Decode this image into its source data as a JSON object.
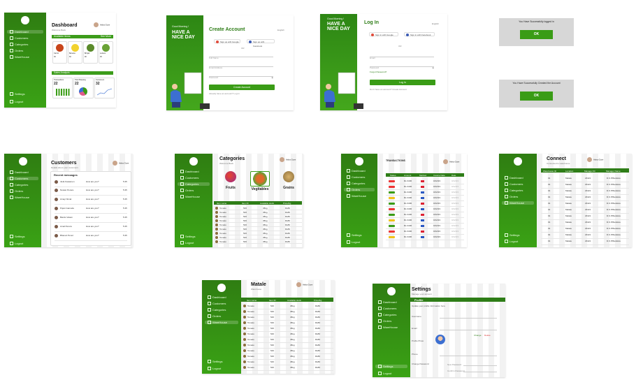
{
  "colors": {
    "brand_green": "#3a9c16",
    "dark_green": "#2e7d17"
  },
  "nav": {
    "dashboard": "Dashboard",
    "customers": "Customers",
    "categories": "Categories",
    "orders": "Orders",
    "warehouse": "WareHouse",
    "settings": "Settings",
    "logout": "Logout"
  },
  "profile": {
    "name": "Asha Gore",
    "role": "Project Manager"
  },
  "dashboard": {
    "title": "Dashboard",
    "subtitle": "Welcome Back",
    "available": "Available Items",
    "see_more": "See More",
    "items": [
      {
        "name": "Carrot",
        "value": "30"
      },
      {
        "name": "Banana",
        "value": "60"
      },
      {
        "name": "Brinjal",
        "value": "90"
      },
      {
        "name": "Lettuce",
        "value": "45"
      }
    ],
    "sales": "Sales Analysis",
    "stats": [
      {
        "label": "Transactions",
        "value": "22"
      },
      {
        "label": "Total Shipping",
        "value": "22"
      },
      {
        "label": "Customers",
        "value": "32"
      }
    ]
  },
  "create": {
    "hello": "Good Morning !",
    "big1": "HAVE A",
    "big2": "NICE DAY",
    "title": "Create Account",
    "lang": "English",
    "google": "Sign up with Google",
    "facebook": "Sign up with Facebook",
    "or": "OR",
    "f1": "Full Name",
    "f2": "Email Address",
    "f3": "Password",
    "button": "Create Account",
    "foot": "Already have an account? Log In"
  },
  "login": {
    "hello": "Good Morning !",
    "big1": "HAVE A",
    "big2": "NICE DAY",
    "title": "Log In",
    "lang": "English",
    "google": "Sign in with Google",
    "facebook": "Sign in with Facebook",
    "or": "OR",
    "f1": "Email",
    "f2": "Password",
    "forgot": "Forgot Password?",
    "button": "Log In",
    "foot": "Don't have an account? Create Account"
  },
  "modal1": {
    "msg": "You Have Successfully logged in",
    "ok": "OK"
  },
  "modal2": {
    "msg": "You Have Successfully Created the Account",
    "ok": "OK"
  },
  "customers": {
    "title": "Customers",
    "subtitle": "Details about your customers",
    "recent": "Recent messages",
    "rows": [
      {
        "name": "Jiefa Kawamen",
        "msg": "How are you?",
        "time": "5:45"
      },
      {
        "name": "Nuwan Perera",
        "msg": "How are you?",
        "time": "5:45"
      },
      {
        "name": "Amay Nimal",
        "msg": "How are you?",
        "time": "5:45"
      },
      {
        "name": "Pujan Gamude",
        "msg": "How are you?",
        "time": "5:45"
      },
      {
        "name": "Bandu Vasan",
        "msg": "How are you?",
        "time": "5:45"
      },
      {
        "name": "Amal Perera",
        "msg": "How are you?",
        "time": "5:45"
      },
      {
        "name": "Bhanuri Perez",
        "msg": "How are you?",
        "time": "5:45"
      }
    ]
  },
  "categories": {
    "title": "Categories",
    "subtitle": "Welcome Back",
    "cats": [
      "Fruits",
      "Vegitables",
      "Grains"
    ],
    "cols": [
      "Item name",
      "Item ID",
      "Available stock",
      "Price/Kg"
    ],
    "row": [
      "Tomato",
      "546",
      "45kg",
      "Rs80"
    ]
  },
  "transactions": {
    "title": "TRANSACTIONS",
    "cols": [
      "Status",
      "Amount",
      "Method",
      "Invoice Date",
      "Date"
    ],
    "amount": "Rs 3400",
    "invoice": "0/12/23",
    "date": "0/12/23"
  },
  "connect": {
    "title": "Connect",
    "subtitle": "Connected to warehouse",
    "cols": [
      "Warehouse ID",
      "Location",
      "Manager ID",
      "Manager Name"
    ],
    "row": [
      "01",
      "Matale",
      "23421",
      "D.K.P.Bandara"
    ]
  },
  "matale": {
    "title": "Matale",
    "subtitle": "Warehouse",
    "cols": [
      "Item name",
      "Item ID",
      "Available stock",
      "Price/Kg"
    ],
    "row": [
      "Tomato",
      "546",
      "45kg",
      "Rs80"
    ]
  },
  "settings": {
    "title": "Settings",
    "subtitle": "Manage your account",
    "profile": "Profile",
    "update": "Update your profile information here",
    "f1": "Username",
    "f2": "Email",
    "f3": "Profile Photo",
    "f4": "Phone",
    "f5": "Change Password",
    "change": "Change",
    "delete": "Delete",
    "f6": "New Password",
    "f7": "Confirm Password"
  }
}
